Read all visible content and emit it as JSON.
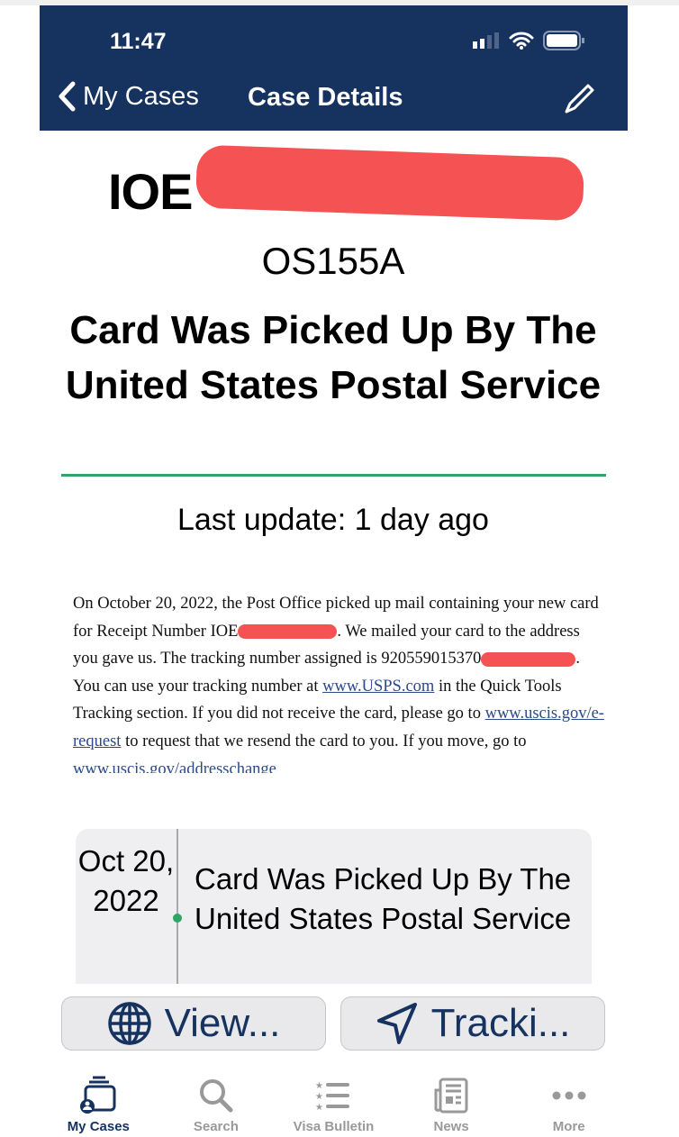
{
  "status_bar": {
    "time": "11:47"
  },
  "nav": {
    "back_label": "My Cases",
    "title": "Case Details"
  },
  "case": {
    "receipt_prefix": "IOE",
    "receipt_suffix": "OS155A",
    "status_title": "Card Was Picked Up By The United States Postal Service",
    "last_update": "Last update: 1 day ago"
  },
  "description": {
    "p1": "On October 20, 2022, the Post Office picked up mail containing your new card for Receipt Number IOE",
    "p2": ". We mailed your card to the address you gave us. The tracking number assigned is 920559015370",
    "p3": ". You can use your tracking number at ",
    "link1": "www.USPS.com",
    "p4": " in the Quick Tools Tracking section. If you did not receive the card, please go to ",
    "link2": "www.uscis.gov/e-request",
    "p5": " to request that we resend the card to you. If you move, go to ",
    "link3": "www.uscis.gov/addresschange"
  },
  "timeline": [
    {
      "date": "Oct 20, 2022",
      "title": "Card Was Picked Up By The United States Postal Service"
    }
  ],
  "actions": {
    "view_label": "View...",
    "tracking_label": "Tracki..."
  },
  "tabs": [
    {
      "label": "My Cases",
      "icon": "cases-icon",
      "active": true
    },
    {
      "label": "Search",
      "icon": "search-icon"
    },
    {
      "label": "Visa Bulletin",
      "icon": "list-icon"
    },
    {
      "label": "News",
      "icon": "newspaper-icon"
    },
    {
      "label": "More",
      "icon": "ellipsis-icon"
    }
  ],
  "colors": {
    "nav_bg": "#16325f",
    "accent_green": "#2fa565",
    "redaction": "#f55353"
  }
}
